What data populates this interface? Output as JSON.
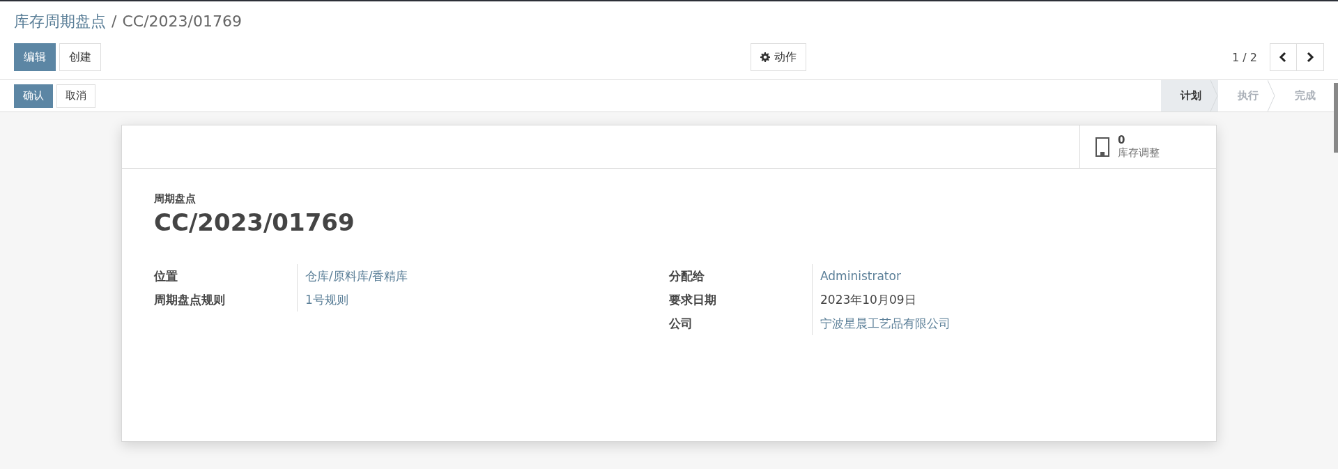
{
  "breadcrumb": {
    "parent": "库存周期盘点",
    "separator": "/",
    "current": "CC/2023/01769"
  },
  "main_buttons": [
    {
      "label": "编辑",
      "primary": true
    },
    {
      "label": "创建",
      "primary": false
    }
  ],
  "action_button": {
    "label": "动作"
  },
  "pager": {
    "counter": "1 / 2"
  },
  "status_buttons": [
    {
      "label": "确认",
      "primary": true
    },
    {
      "label": "取消",
      "primary": false
    }
  ],
  "stages": [
    {
      "label": "计划",
      "selected": true
    },
    {
      "label": "执行",
      "selected": false
    },
    {
      "label": "完成",
      "selected": false
    }
  ],
  "stat_button": {
    "value": "0",
    "label": "库存调整"
  },
  "form": {
    "subtitle": "周期盘点",
    "title": "CC/2023/01769",
    "left_fields": [
      {
        "label": "位置",
        "value": "仓库/原料库/香精库",
        "kind": "link"
      },
      {
        "label": "周期盘点规则",
        "value": "1号规则",
        "kind": "link"
      }
    ],
    "right_fields": [
      {
        "label": "分配给",
        "value": "Administrator",
        "kind": "link"
      },
      {
        "label": "要求日期",
        "value": "2023年10月09日",
        "kind": "text"
      },
      {
        "label": "公司",
        "value": "宁波星晨工艺品有限公司",
        "kind": "link"
      }
    ]
  }
}
